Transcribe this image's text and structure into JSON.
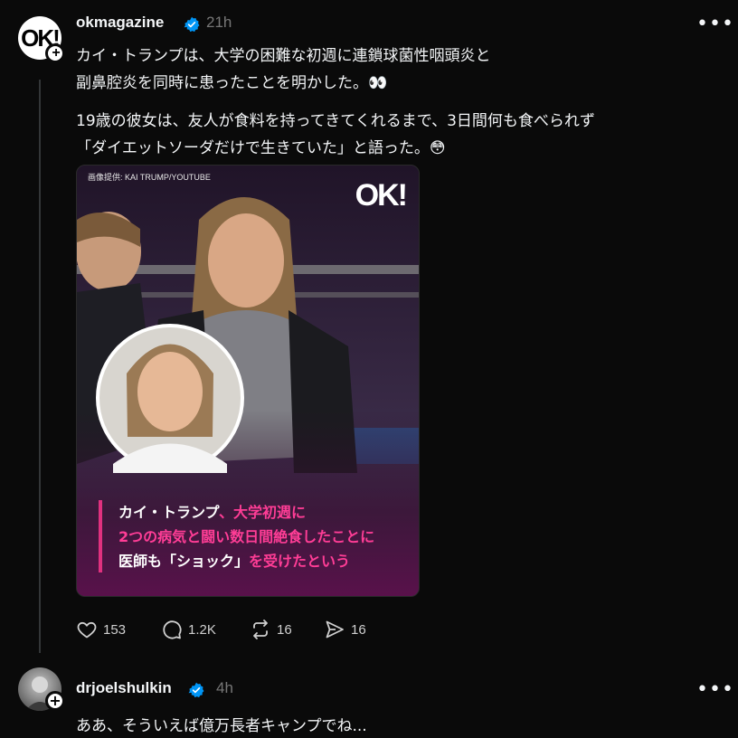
{
  "post": {
    "avatar_text": "OK!",
    "username": "okmagazine",
    "time": "21h",
    "more_label": "•••",
    "body_lines": [
      "カイ・トランプは、大学の困難な初週に連鎖球菌性咽頭炎と",
      "副鼻腔炎を同時に患ったことを明かした。",
      "19歳の彼女は、友人が食料を持ってきてくれるまで、3日間何も食べられず",
      "「ダイエットソーダだけで生きていた」と語った。"
    ],
    "emoji_eyes": "👀",
    "emoji_flushed": "😳",
    "media": {
      "credit": "画像提供: KAI TRUMP/YOUTUBE",
      "logo": "OK!",
      "logo_small": "PLUS",
      "caption_l1_white": "カイ・トランプ",
      "caption_l1_pink": "、大学初週に",
      "caption_l2": "2つの病気と闘い数日間絶食したことに",
      "caption_l3_white": "医師も「ショック」",
      "caption_l3_pink": "を受けたという"
    },
    "actions": {
      "likes": "153",
      "comments": "1.2K",
      "reposts": "16",
      "shares": "16"
    }
  },
  "reply": {
    "username": "drjoelshulkin",
    "time": "4h",
    "more_label": "•••",
    "text": "ああ、そういえば億万長者キャンプでね..."
  },
  "colors": {
    "background": "#0a0a0a",
    "verified": "#0095f6",
    "caption_pink": "#ff3d96",
    "caption_bar": "#e0317f"
  }
}
